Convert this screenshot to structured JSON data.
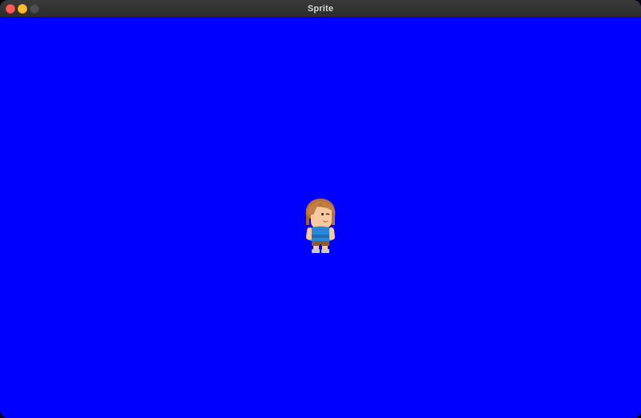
{
  "window": {
    "title": "Sprite"
  },
  "controls": {
    "close": "close-button",
    "minimize": "minimize-button",
    "zoom": "zoom-button"
  },
  "colors": {
    "background": "#0000ff",
    "close": "#fe5f57",
    "minimize": "#febc2e",
    "zoom": "#4e4e4e"
  },
  "sprite": {
    "icon": "character-sprite"
  }
}
